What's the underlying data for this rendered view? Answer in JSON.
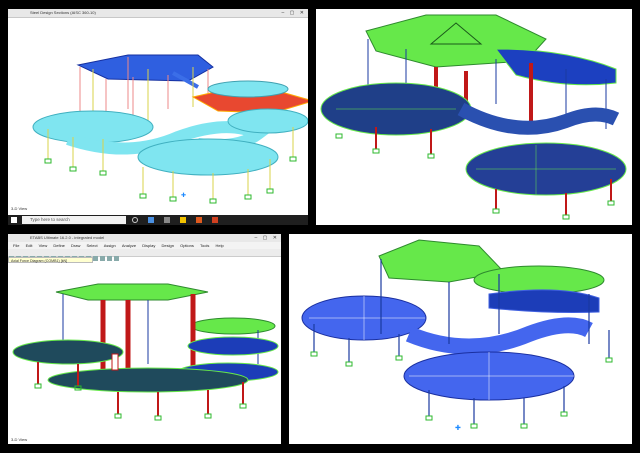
{
  "panel1": {
    "window_title": "Steel Design Sections (AISC 360-10)",
    "status_text": "3-D View",
    "search_placeholder": "Type here to search"
  },
  "panel3": {
    "window_title": "ETABS Ultimate 16.2.0 - integrated model",
    "menus": [
      "File",
      "Edit",
      "View",
      "Define",
      "Draw",
      "Select",
      "Assign",
      "Analyze",
      "Display",
      "Design",
      "Options",
      "Tools",
      "Help"
    ],
    "doc_tab": "Axial Force Diagram (COMB1) [kN]",
    "status_text": "3-D View"
  },
  "colors": {
    "roof_green": "#66e84a",
    "slab_cyan": "#7fe5f0",
    "frame_blue": "#2040b0",
    "column_red": "#c01818",
    "support_green": "#2db82d",
    "taskbar": "#1f1f1f"
  }
}
